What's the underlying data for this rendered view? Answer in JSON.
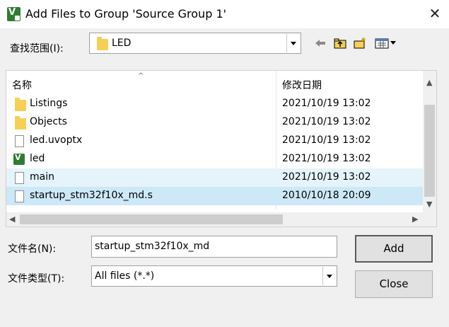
{
  "window": {
    "title": "Add Files to Group 'Source Group 1'"
  },
  "look_in": {
    "label": "查找范围(I):",
    "value": "LED"
  },
  "toolbar": {
    "icons": [
      "back-arrow-icon",
      "up-folder-icon",
      "new-folder-icon",
      "view-menu-icon"
    ]
  },
  "columns": {
    "name": "名称",
    "date": "修改日期"
  },
  "files": [
    {
      "name": "Listings",
      "date": "2021/10/19 13:02",
      "icon": "folder-icon"
    },
    {
      "name": "Objects",
      "date": "2021/10/19 13:02",
      "icon": "folder-icon"
    },
    {
      "name": "led.uvoptx",
      "date": "2021/10/19 13:02",
      "icon": "file-icon"
    },
    {
      "name": "led",
      "date": "2021/10/19 13:02",
      "icon": "uvision-project-icon"
    },
    {
      "name": "main",
      "date": "2021/10/19 13:02",
      "icon": "file-icon"
    },
    {
      "name": "startup_stm32f10x_md.s",
      "date": "2010/10/18 20:09",
      "icon": "file-icon"
    }
  ],
  "filename": {
    "label": "文件名(N):",
    "value": "startup_stm32f10x_md"
  },
  "filetype": {
    "label": "文件类型(T):",
    "value": "All files (*.*)"
  },
  "buttons": {
    "add": "Add",
    "close": "Close"
  }
}
